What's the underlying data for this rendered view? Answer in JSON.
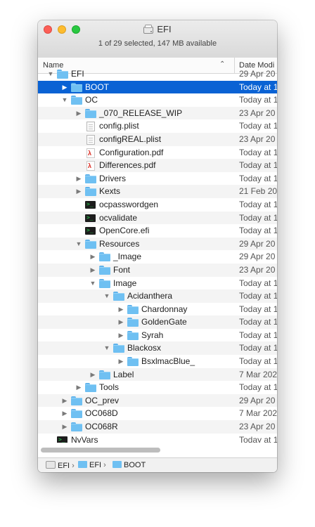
{
  "window": {
    "title": "EFI",
    "status": "1 of 29 selected, 147 MB available"
  },
  "columns": {
    "name": "Name",
    "date": "Date Modi"
  },
  "rows": [
    {
      "name": "EFI",
      "date": "29 Apr 20",
      "indent": 0,
      "disclosure": "open",
      "icon": "folder-icon"
    },
    {
      "name": "BOOT",
      "date": "Today at 1",
      "indent": 1,
      "disclosure": "closed",
      "icon": "folder-icon",
      "selected": true
    },
    {
      "name": "OC",
      "date": "Today at 1",
      "indent": 1,
      "disclosure": "open",
      "icon": "folder-icon"
    },
    {
      "name": "_070_RELEASE_WIP",
      "date": "23 Apr 20",
      "indent": 2,
      "disclosure": "closed",
      "icon": "folder-icon"
    },
    {
      "name": "config.plist",
      "date": "Today at 1",
      "indent": 2,
      "disclosure": "none",
      "icon": "document-icon"
    },
    {
      "name": "configREAL.plist",
      "date": "23 Apr 20",
      "indent": 2,
      "disclosure": "none",
      "icon": "document-icon"
    },
    {
      "name": "Configuration.pdf",
      "date": "Today at 1",
      "indent": 2,
      "disclosure": "none",
      "icon": "pdf-icon"
    },
    {
      "name": "Differences.pdf",
      "date": "Today at 1",
      "indent": 2,
      "disclosure": "none",
      "icon": "pdf-icon"
    },
    {
      "name": "Drivers",
      "date": "Today at 1",
      "indent": 2,
      "disclosure": "closed",
      "icon": "folder-icon"
    },
    {
      "name": "Kexts",
      "date": "21 Feb 20",
      "indent": 2,
      "disclosure": "closed",
      "icon": "folder-icon"
    },
    {
      "name": "ocpasswordgen",
      "date": "Today at 1",
      "indent": 2,
      "disclosure": "none",
      "icon": "executable-icon"
    },
    {
      "name": "ocvalidate",
      "date": "Today at 1",
      "indent": 2,
      "disclosure": "none",
      "icon": "executable-icon"
    },
    {
      "name": "OpenCore.efi",
      "date": "Today at 1",
      "indent": 2,
      "disclosure": "none",
      "icon": "executable-icon"
    },
    {
      "name": "Resources",
      "date": "29 Apr 20",
      "indent": 2,
      "disclosure": "open",
      "icon": "folder-icon"
    },
    {
      "name": "_Image",
      "date": "29 Apr 20",
      "indent": 3,
      "disclosure": "closed",
      "icon": "folder-icon"
    },
    {
      "name": "Font",
      "date": "23 Apr 20",
      "indent": 3,
      "disclosure": "closed",
      "icon": "folder-icon"
    },
    {
      "name": "Image",
      "date": "Today at 1",
      "indent": 3,
      "disclosure": "open",
      "icon": "folder-icon"
    },
    {
      "name": "Acidanthera",
      "date": "Today at 1",
      "indent": 4,
      "disclosure": "open",
      "icon": "folder-icon"
    },
    {
      "name": "Chardonnay",
      "date": "Today at 1",
      "indent": 5,
      "disclosure": "closed",
      "icon": "folder-icon"
    },
    {
      "name": "GoldenGate",
      "date": "Today at 1",
      "indent": 5,
      "disclosure": "closed",
      "icon": "folder-icon"
    },
    {
      "name": "Syrah",
      "date": "Today at 1",
      "indent": 5,
      "disclosure": "closed",
      "icon": "folder-icon"
    },
    {
      "name": "Blackosx",
      "date": "Today at 1",
      "indent": 4,
      "disclosure": "open",
      "icon": "folder-icon"
    },
    {
      "name": "BsxlmacBlue_",
      "date": "Today at 1",
      "indent": 5,
      "disclosure": "closed",
      "icon": "folder-icon"
    },
    {
      "name": "Label",
      "date": "7 Mar 202",
      "indent": 3,
      "disclosure": "closed",
      "icon": "folder-icon"
    },
    {
      "name": "Tools",
      "date": "Today at 1",
      "indent": 2,
      "disclosure": "closed",
      "icon": "folder-icon"
    },
    {
      "name": "OC_prev",
      "date": "29 Apr 20",
      "indent": 1,
      "disclosure": "closed",
      "icon": "folder-icon"
    },
    {
      "name": "OC068D",
      "date": "7 Mar 202",
      "indent": 1,
      "disclosure": "closed",
      "icon": "folder-icon"
    },
    {
      "name": "OC068R",
      "date": "23 Apr 20",
      "indent": 1,
      "disclosure": "closed",
      "icon": "folder-icon"
    },
    {
      "name": "NvVars",
      "date": "Today at 1",
      "indent": 0,
      "disclosure": "none",
      "icon": "executable-icon"
    }
  ],
  "pathbar": [
    {
      "label": "EFI",
      "icon": "drive-icon"
    },
    {
      "label": "EFI",
      "icon": "folder-icon"
    },
    {
      "label": "BOOT",
      "icon": "folder-icon"
    }
  ],
  "colors": {
    "selection": "#0a62d4",
    "folder": "#6fc0f2"
  }
}
